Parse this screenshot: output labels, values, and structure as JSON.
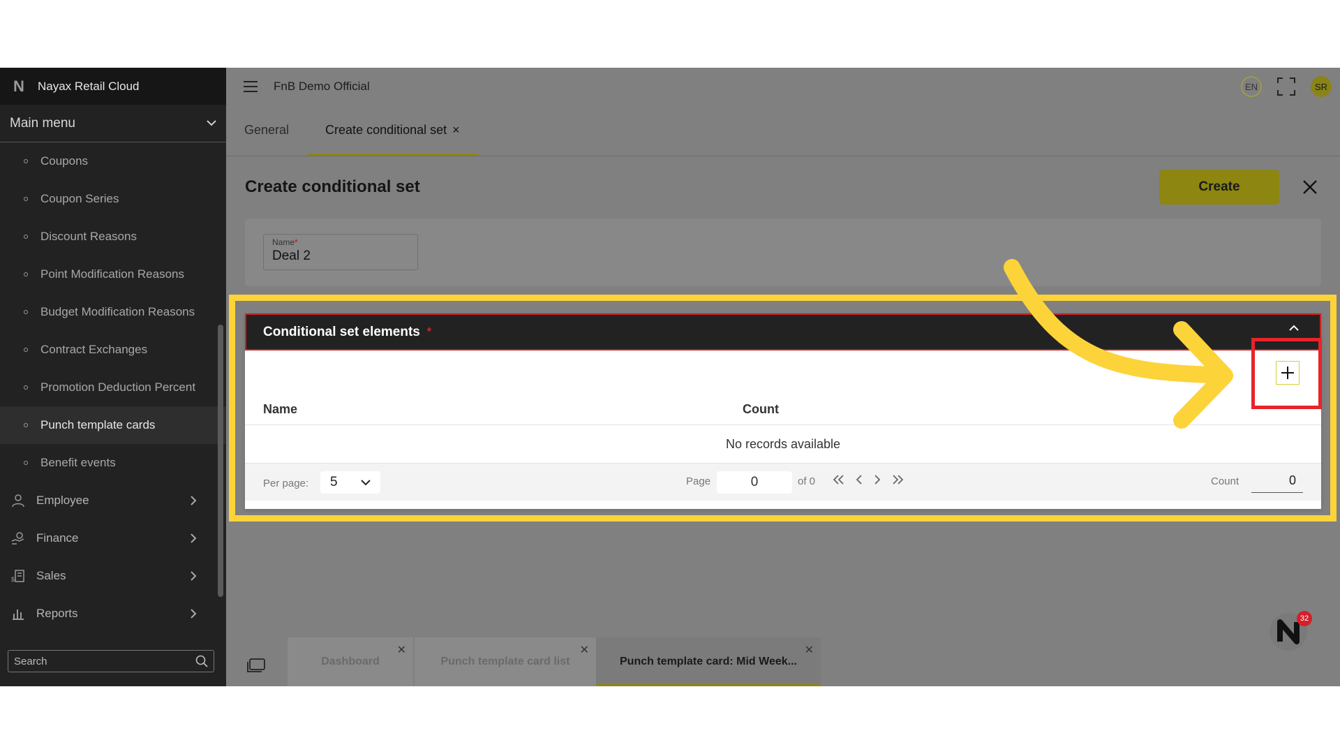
{
  "app": {
    "brand": "Nayax Retail Cloud",
    "organization": "FnB Demo Official",
    "language": "EN",
    "user_initials": "SR"
  },
  "sidebar": {
    "main_menu": "Main menu",
    "sub_items": [
      "Coupons",
      "Coupon Series",
      "Discount Reasons",
      "Point Modification Reasons",
      "Budget Modification Reasons",
      "Contract Exchanges",
      "Promotion Deduction Percent",
      "Punch template cards",
      "Benefit events"
    ],
    "active_item": "Punch template cards",
    "groups": [
      "Employee",
      "Finance",
      "Sales",
      "Reports"
    ],
    "search_placeholder": "Search"
  },
  "tabs": [
    {
      "label": "General"
    },
    {
      "label": "Create conditional set"
    }
  ],
  "page": {
    "title": "Create conditional set",
    "create_label": "Create",
    "name_label": "Name",
    "name_required": "*",
    "name_value": "Deal 2"
  },
  "section": {
    "title": "Conditional set elements",
    "required_mark": "*",
    "columns": [
      "Name",
      "Count"
    ],
    "empty_text": "No records available",
    "per_page_label": "Per page:",
    "per_page_value": "5",
    "page_label": "Page",
    "page_value": "0",
    "of_label": "of 0",
    "count_label": "Count",
    "count_value": "0"
  },
  "bottom_tabs": [
    {
      "label": "Dashboard"
    },
    {
      "label": "Punch template card list"
    },
    {
      "label": "Punch template card: Mid Week..."
    }
  ],
  "notification_count": "32",
  "colors": {
    "highlight": "#fdd33a",
    "red_box": "#e8232a",
    "accent": "#8d8610"
  }
}
